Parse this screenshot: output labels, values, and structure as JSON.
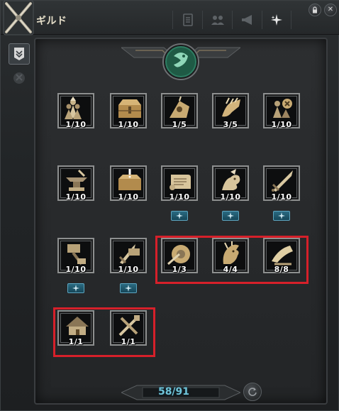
{
  "window": {
    "title": "ギルド"
  },
  "tabs": [
    {
      "icon": "document-icon"
    },
    {
      "icon": "members-icon"
    },
    {
      "icon": "megaphone-icon"
    },
    {
      "icon": "sparkle-icon"
    }
  ],
  "controls": {
    "lock_icon": "lock-icon",
    "close_icon": "close-icon",
    "close_label": "✕"
  },
  "sidebar": [
    {
      "icon": "guild-banner-icon",
      "active": true
    },
    {
      "icon": "shield-icon",
      "active": false
    }
  ],
  "skills": [
    {
      "icon": "members-icon",
      "level": "1/10",
      "upgrade": false
    },
    {
      "icon": "treasure-chest-icon",
      "level": "1/10",
      "upgrade": false
    },
    {
      "icon": "horn-icon",
      "level": "1/5",
      "upgrade": false
    },
    {
      "icon": "hand-gold-icon",
      "level": "3/5",
      "upgrade": false
    },
    {
      "icon": "members-x-icon",
      "level": "1/10",
      "upgrade": false
    },
    {
      "icon": "anvil-icon",
      "level": "1/10",
      "upgrade": false
    },
    {
      "icon": "chest-alert-icon",
      "level": "1/10",
      "upgrade": false
    },
    {
      "icon": "scroll-icon",
      "level": "1/10",
      "upgrade": true
    },
    {
      "icon": "dragon-icon",
      "level": "1/10",
      "upgrade": true
    },
    {
      "icon": "sword-icon",
      "level": "1/10",
      "upgrade": true
    },
    {
      "icon": "hammer-icon",
      "level": "1/10",
      "upgrade": true
    },
    {
      "icon": "sword-hammer-icon",
      "level": "1/10",
      "upgrade": true
    },
    {
      "icon": "shield-sword-icon",
      "level": "1/3",
      "upgrade": false
    },
    {
      "icon": "dragon-head-icon",
      "level": "4/4",
      "upgrade": false
    },
    {
      "icon": "horn-scroll-icon",
      "level": "8/8",
      "upgrade": false
    },
    {
      "icon": "house-icon",
      "level": "1/1",
      "upgrade": false
    },
    {
      "icon": "tools-icon",
      "level": "1/1",
      "upgrade": false
    }
  ],
  "footer": {
    "points": "58/91"
  },
  "colors": {
    "accent": "#6fc3d8",
    "highlight": "#d6202a",
    "upgrade": "#2a6a82"
  }
}
